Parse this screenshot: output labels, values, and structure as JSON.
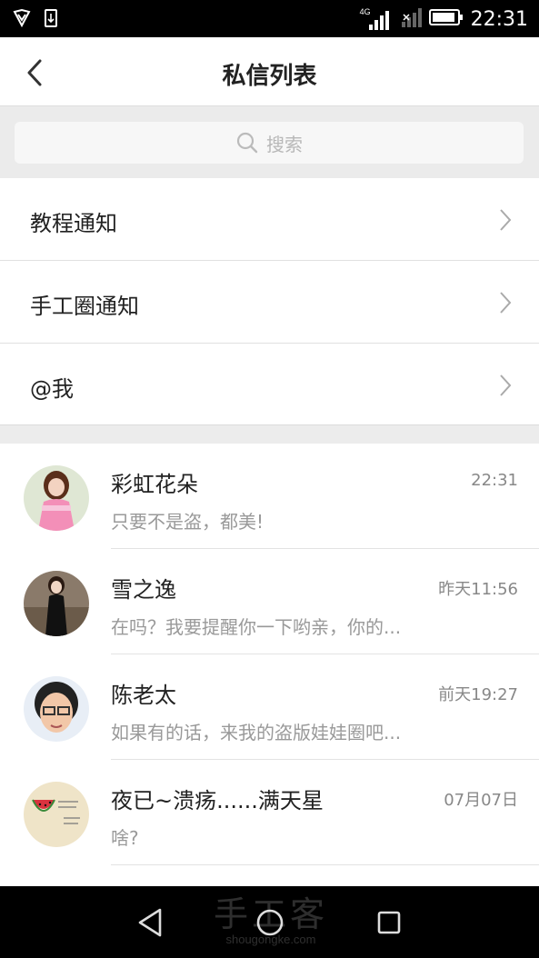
{
  "status_bar": {
    "network_label": "4G",
    "time": "22:31"
  },
  "header": {
    "title": "私信列表"
  },
  "search": {
    "placeholder": "搜索"
  },
  "notices": [
    {
      "label": "教程通知"
    },
    {
      "label": "手工圈通知"
    },
    {
      "label": "@我"
    }
  ],
  "conversations": [
    {
      "name": "彩虹花朵",
      "time": "22:31",
      "preview": "只要不是盗，都美!",
      "avatar": "doll-pink-avatar"
    },
    {
      "name": "雪之逸",
      "time": "昨天11:56",
      "preview": "在吗？我要提醒你一下哟亲，你的...",
      "avatar": "doll-black-dress-avatar"
    },
    {
      "name": "陈老太",
      "time": "前天19:27",
      "preview": "如果有的话，来我的盗版娃娃圈吧...",
      "avatar": "person-glasses-avatar"
    },
    {
      "name": "夜已~溃疡......满天星",
      "time": "07月07日",
      "preview": "啥?",
      "avatar": "watermelon-avatar"
    }
  ],
  "watermark": {
    "cn": "手工客",
    "en": "shougongke.com"
  },
  "colors": {
    "background": "#f0f0f0",
    "status_bar": "#000000",
    "header_bg": "#ffffff",
    "text_primary": "#222222",
    "text_secondary": "#999999"
  }
}
